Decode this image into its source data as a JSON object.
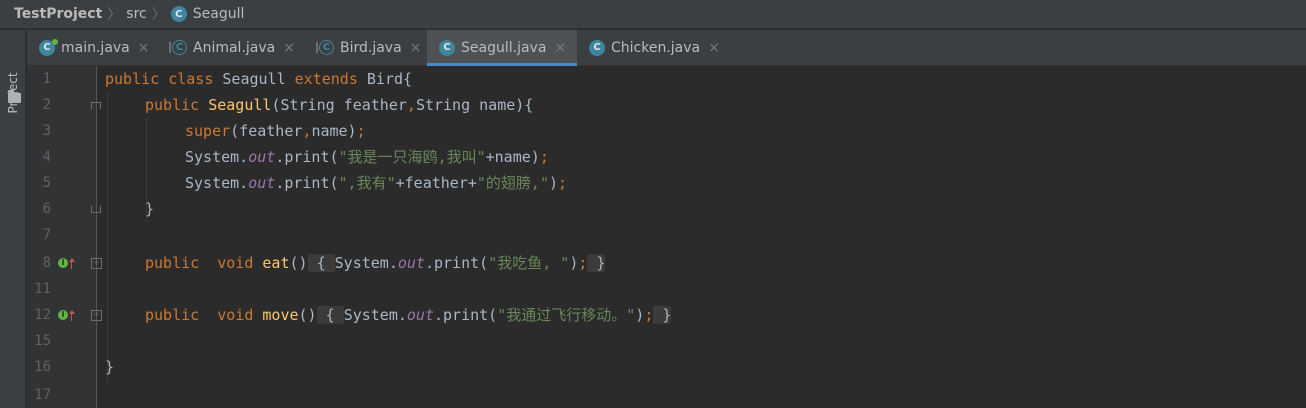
{
  "breadcrumb": {
    "project": "TestProject",
    "folder": "src",
    "file": "Seagull"
  },
  "sidebar": {
    "label": "Project"
  },
  "tabs": [
    {
      "label": "main.java",
      "close": "×",
      "active": false
    },
    {
      "label": "Animal.java",
      "close": "×",
      "active": false
    },
    {
      "label": "Bird.java",
      "close": "×",
      "active": false
    },
    {
      "label": "Seagull.java",
      "close": "×",
      "active": true
    },
    {
      "label": "Chicken.java",
      "close": "×",
      "active": false
    }
  ],
  "editor": {
    "line_numbers": [
      "1",
      "2",
      "3",
      "4",
      "5",
      "6",
      "7",
      "8",
      "11",
      "12",
      "15",
      "16",
      "17"
    ],
    "tokens": {
      "l1": [
        "public class",
        " Seagull ",
        "extends",
        " Bird{"
      ],
      "l2": [
        "public ",
        "Seagull",
        "(String feather",
        ",",
        "String name){"
      ],
      "l3": [
        "super",
        "(feather",
        ",",
        "name)",
        ";"
      ],
      "l4": [
        "System.",
        "out",
        ".print(",
        "\"我是一只海鸥,我叫\"",
        "+name)",
        ";"
      ],
      "l5": [
        "System.",
        "out",
        ".print(",
        "\",我有\"",
        "+feather+",
        "\"的翅膀,\"",
        ")",
        ";"
      ],
      "l6": [
        "}"
      ],
      "l8": [
        "public  void ",
        "eat",
        "()",
        " { ",
        "System.",
        "out",
        ".print(",
        "\"我吃鱼, \"",
        ")",
        ";",
        " }"
      ],
      "l12": [
        "public  void ",
        "move",
        "()",
        " { ",
        "System.",
        "out",
        ".print(",
        "\"我通过飞行移动。\"",
        ")",
        ";",
        " }"
      ],
      "l16": [
        "}"
      ]
    }
  },
  "colors": {
    "keyword": "#cc7832",
    "function": "#ffc66d",
    "string": "#6a8759",
    "field": "#9876aa",
    "text": "#a9b7c6",
    "accent": "#4a88c7"
  },
  "icons": {
    "class_icon_letter": "C"
  }
}
